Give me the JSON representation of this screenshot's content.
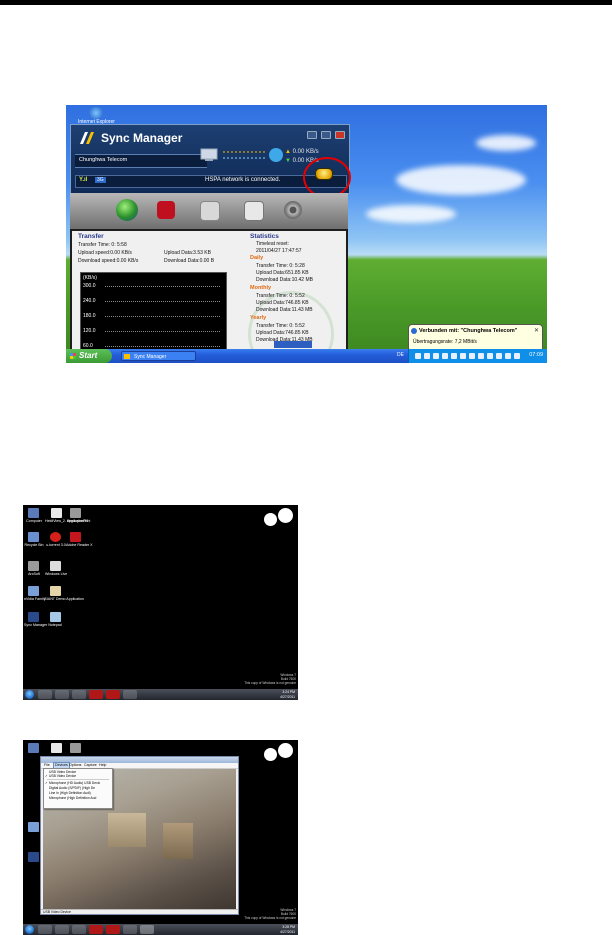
{
  "screenshot1": {
    "desktop_icon_label": "Internet Explorer",
    "app_title": "Sync Manager",
    "provider": "Chunghwa Telecom",
    "upload_rate": "0.00 KB/s",
    "download_rate": "0.00 KB/s",
    "signal_badge": "3G",
    "status_text": "HSPA network is connected.",
    "transfer": {
      "heading": "Transfer",
      "time": "Transfer Time: 0: 5:58",
      "upload_speed": "Upload speed:0.00 KB/s",
      "download_speed": "Download speed:0.00 KB/s",
      "upload_data": "Upload Data:3.53 KB",
      "download_data": "Download Data:0.00 B"
    },
    "graph": {
      "unit": "(KB/s)",
      "y_ticks": [
        "300.0",
        "240.0",
        "180.0",
        "120.0",
        "60.0"
      ]
    },
    "statistics": {
      "heading": "Statistics",
      "last_reset_label": "Timeleat reset:",
      "last_reset_value": "2011/04/27 17:47:57",
      "daily_heading": "Daily",
      "daily_time": "Transfer Time: 0: 5:28",
      "daily_upload": "Upload Data:651.85 KB",
      "daily_download": "Download Data:10.42 MB",
      "monthly_heading": "Monthly",
      "monthly_time": "Transfer Time: 0: 5:52",
      "monthly_upload": "Upload Data:746.85 KB",
      "monthly_download": "Download Data:11.43 MB",
      "yearly_heading": "Yearly",
      "yearly_time": "Transfer Time: 0: 5:52",
      "yearly_upload": "Upload Data:746.85 KB",
      "yearly_download": "Download Data:11.43 MB"
    },
    "balloon_title": "Verbunden mit: \"Chunghwa Telecom\"",
    "balloon_message": "Übertragungsrate: 7,2 MBit/s",
    "start_label": "Start",
    "task_label": "Sync Manager",
    "tray_lang": "DE",
    "clock": "07:09"
  },
  "screenshot2": {
    "icons": [
      {
        "label": "Computer"
      },
      {
        "label": "HeidiView_2. application30"
      },
      {
        "label": "EmployeePrint"
      },
      {
        "label": "Recycle Bin"
      },
      {
        "label": "u-torrent 3.0"
      },
      {
        "label": "Adobe Reader X"
      },
      {
        "label": "ArcSoft"
      },
      {
        "label": "Windows Live"
      },
      {
        "label": "nVidia Family"
      },
      {
        "label": "GIANT Demo Application"
      },
      {
        "label": "Sync Manager"
      },
      {
        "label": "Notepad"
      }
    ],
    "watermark": [
      "Windows 7",
      "Build 7600",
      "This copy of Windows is not genuine"
    ],
    "clock": [
      "3:24 PM",
      "4/27/2011"
    ]
  },
  "screenshot3": {
    "menu": [
      "File",
      "Devices",
      "Options",
      "Capture",
      "Help"
    ],
    "dropdown": [
      {
        "label": "USB Video Device",
        "checked": false
      },
      {
        "label": "USB Video Device",
        "checked": true
      },
      {
        "label": "Microphone (HD Audio) USB Devic",
        "checked": true
      },
      {
        "label": "Digital Audio (S/PDIF) (High De",
        "checked": false
      },
      {
        "label": "Line In (High Definition Audi)",
        "checked": false
      },
      {
        "label": "Microphone (High Definition Aud",
        "checked": false
      }
    ],
    "status": "USB Video Device",
    "watermark": [
      "Windows 7",
      "Build 7600",
      "This copy of Windows is not genuine"
    ],
    "clock": [
      "3:28 PM",
      "4/27/2011"
    ]
  }
}
